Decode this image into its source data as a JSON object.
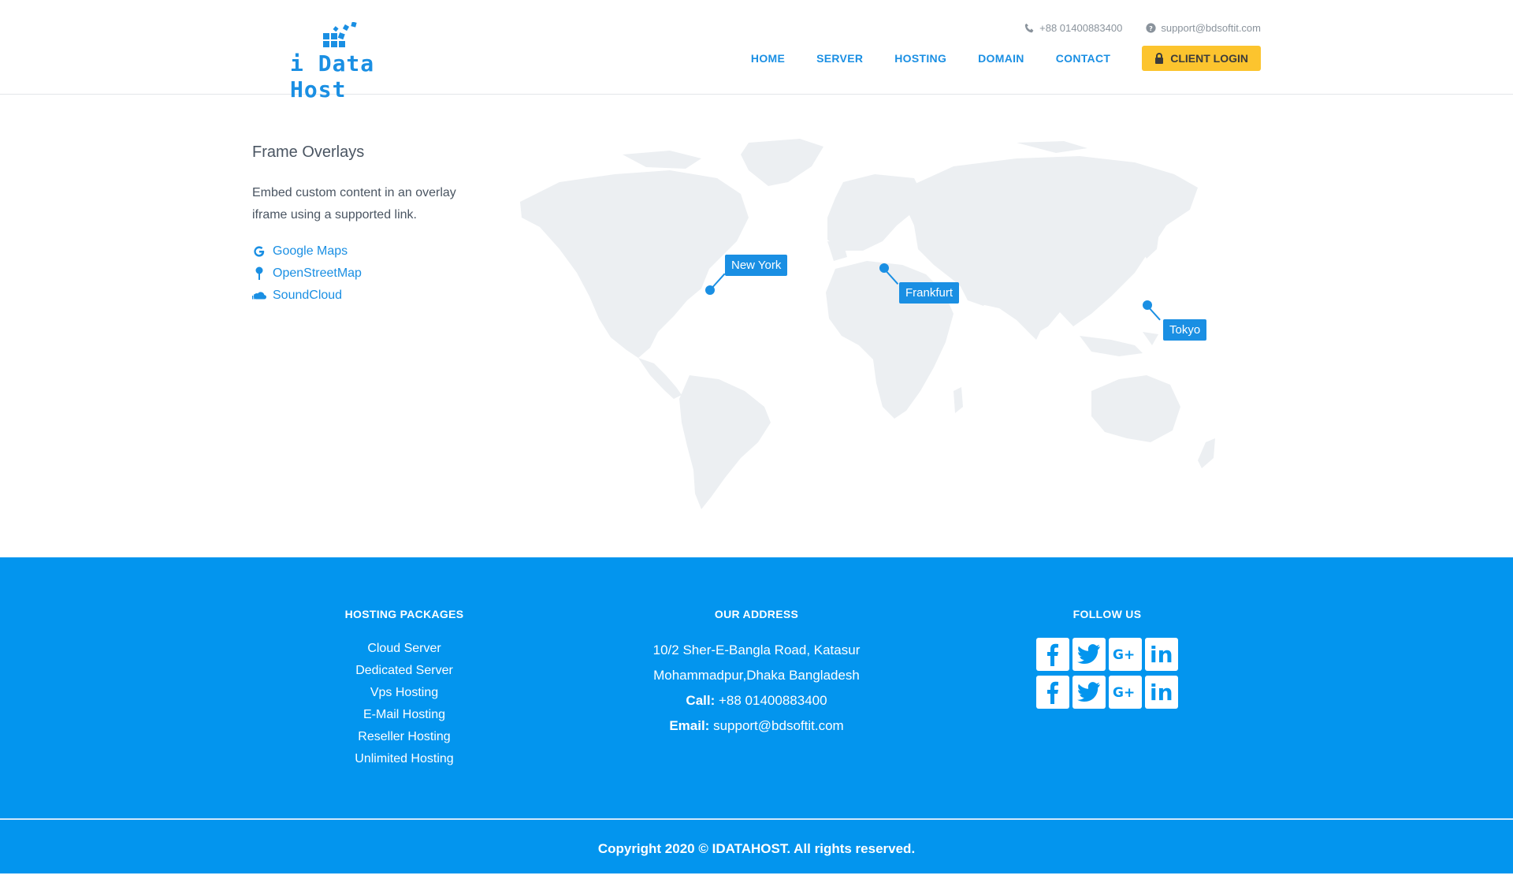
{
  "header": {
    "logo_text": "i Data Host",
    "phone": "+88 01400883400",
    "email": "support@bdsoftit.com",
    "nav": [
      "HOME",
      "SERVER",
      "HOSTING",
      "DOMAIN",
      "CONTACT"
    ],
    "login_label": "CLIENT LOGIN"
  },
  "main": {
    "title": "Frame Overlays",
    "description": "Embed custom content in an overlay iframe using a supported link.",
    "links": [
      {
        "label": "Google Maps",
        "icon": "google-icon"
      },
      {
        "label": "OpenStreetMap",
        "icon": "map-pin-icon"
      },
      {
        "label": "SoundCloud",
        "icon": "soundcloud-icon"
      }
    ],
    "markers": [
      "New York",
      "Frankfurt",
      "Tokyo"
    ]
  },
  "footer": {
    "hosting_title": "HOSTING PACKAGES",
    "hosting_items": [
      "Cloud Server",
      "Dedicated Server",
      "Vps Hosting",
      "E-Mail Hosting",
      "Reseller Hosting",
      "Unlimited Hosting"
    ],
    "address_title": "OUR ADDRESS",
    "address_line1": "10/2 Sher-E-Bangla Road, Katasur",
    "address_line2": "Mohammadpur,Dhaka Bangladesh",
    "call_label": "Call:",
    "call_value": "+88 01400883400",
    "email_label": "Email:",
    "email_value": "support@bdsoftit.com",
    "follow_title": "FOLLOW US",
    "social": [
      "facebook-icon",
      "twitter-icon",
      "google-plus-icon",
      "linkedin-icon"
    ],
    "copyright": "Copyright 2020 © IDATAHOST. All rights reserved."
  },
  "colors": {
    "brand": "#1a8fe3",
    "footer": "#0395ee",
    "login": "#fcc42e",
    "map_land": "#eceff2"
  }
}
